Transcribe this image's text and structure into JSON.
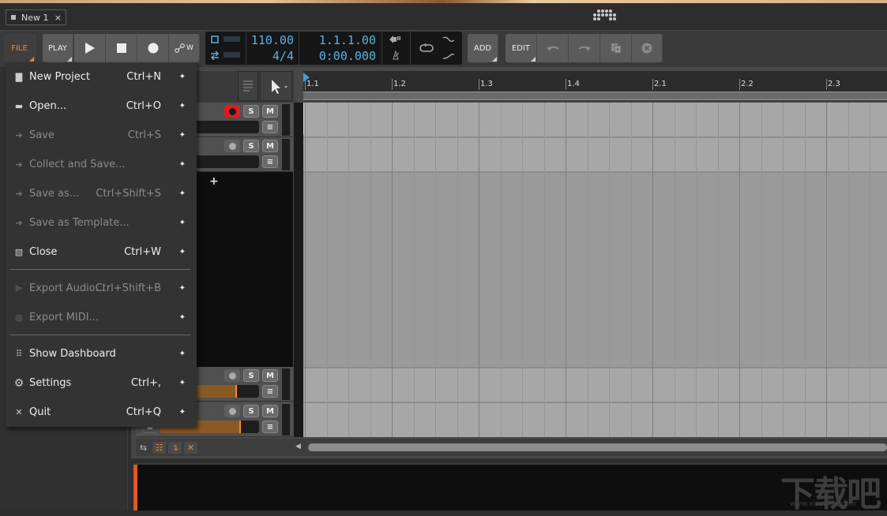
{
  "window": {
    "tab_title": "New 1",
    "tab_close": "×"
  },
  "toolbar": {
    "file_label": "FILE",
    "play_label": "PLAY",
    "automation_label": "W",
    "tempo": "110.00",
    "time_signature": "4/4",
    "position_beats": "1.1.1.00",
    "position_time": "0:00.000",
    "add_label": "ADD",
    "edit_label": "EDIT"
  },
  "file_menu": {
    "items": [
      {
        "label": "New Project",
        "shortcut": "Ctrl+N",
        "icon": "new-document-icon",
        "enabled": true
      },
      {
        "label": "Open...",
        "shortcut": "Ctrl+O",
        "icon": "folder-icon",
        "enabled": true
      },
      {
        "label": "Save",
        "shortcut": "Ctrl+S",
        "icon": "save-icon",
        "enabled": false
      },
      {
        "label": "Collect and Save...",
        "shortcut": "",
        "icon": "collect-save-icon",
        "enabled": false
      },
      {
        "label": "Save as...",
        "shortcut": "Ctrl+Shift+S",
        "icon": "save-as-icon",
        "enabled": false
      },
      {
        "label": "Save as Template...",
        "shortcut": "",
        "icon": "save-template-icon",
        "enabled": false
      },
      {
        "label": "Close",
        "shortcut": "Ctrl+W",
        "icon": "close-document-icon",
        "enabled": true
      },
      {
        "label": "Export Audio...",
        "shortcut": "Ctrl+Shift+B",
        "icon": "waveform-icon",
        "enabled": false
      },
      {
        "label": "Export MIDI...",
        "shortcut": "",
        "icon": "midi-icon",
        "enabled": false
      },
      {
        "label": "Show Dashboard",
        "shortcut": "",
        "icon": "dashboard-icon",
        "enabled": true
      },
      {
        "label": "Settings",
        "shortcut": "Ctrl+,",
        "icon": "gear-icon",
        "enabled": true
      },
      {
        "label": "Quit",
        "shortcut": "Ctrl+Q",
        "icon": "x-icon",
        "enabled": true
      }
    ],
    "pin_glyph": "📌"
  },
  "ruler": {
    "labels": [
      "1.1",
      "1.2",
      "1.3",
      "1.4",
      "2.1",
      "2.2",
      "2.3"
    ]
  },
  "tracks": [
    {
      "armed": true,
      "solo_label": "S",
      "mute_label": "M",
      "level": 0.43
    },
    {
      "armed": false,
      "solo_label": "S",
      "mute_label": "M",
      "level": 0.43
    },
    {
      "armed": false,
      "solo_label": "S",
      "mute_label": "M",
      "level": 0.82
    },
    {
      "armed": false,
      "solo_label": "S",
      "mute_label": "M",
      "level": 0.82
    }
  ],
  "add_track_glyph": "+",
  "watermark": {
    "text": "下载吧",
    "url": "www.xiazaiba.com"
  }
}
